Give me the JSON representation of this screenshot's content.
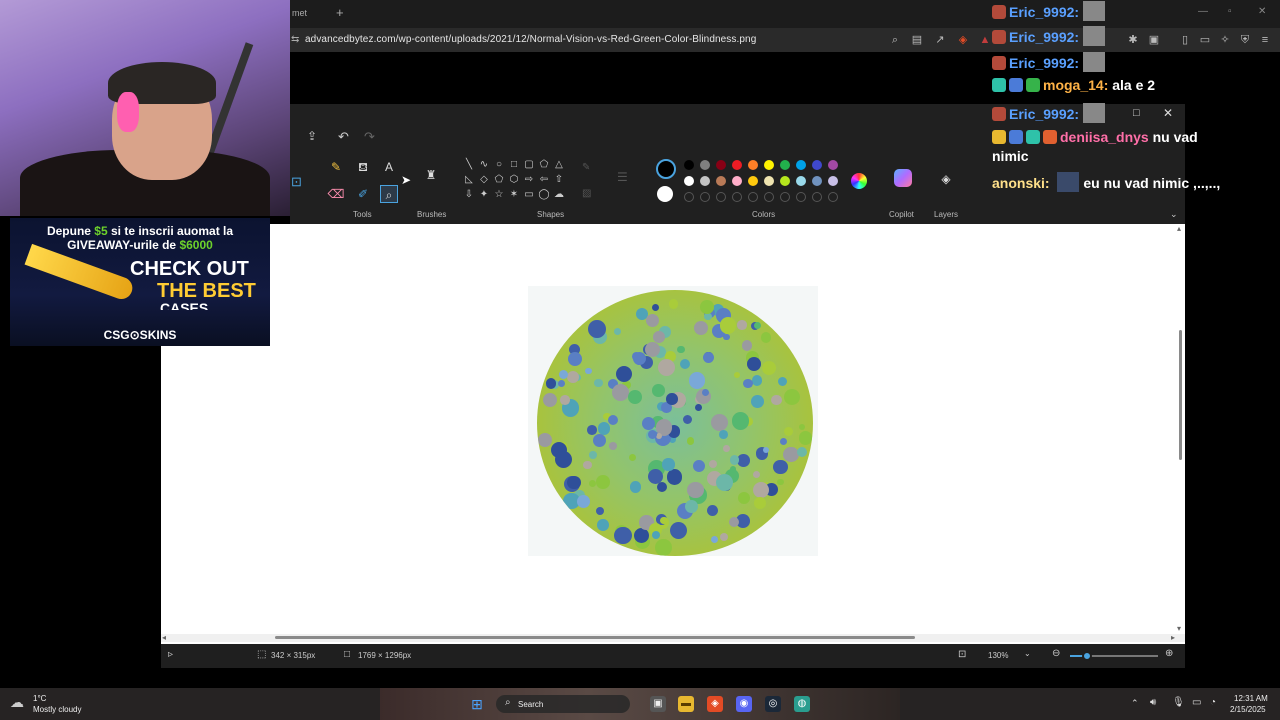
{
  "browser": {
    "tab_partial_label": "met",
    "new_tab_icon": "+",
    "url": "advancedbytez.com/wp-content/uploads/2021/12/Normal-Vision-vs-Red-Green-Color-Blindness.png"
  },
  "paint": {
    "ribbon_groups": [
      "Tools",
      "Brushes",
      "Shapes",
      "Colors",
      "Copilot",
      "Layers"
    ],
    "colors_row1": [
      "#000000",
      "#7f7f7f",
      "#880015",
      "#ed1c24",
      "#ff7f27",
      "#fff200",
      "#22b14c",
      "#00a2e8",
      "#3f48cc",
      "#a349a4"
    ],
    "colors_row2": [
      "#ffffff",
      "#c3c3c3",
      "#b97a57",
      "#ffaec9",
      "#ffc90e",
      "#efe4b0",
      "#b5e61d",
      "#99d9ea",
      "#7092be",
      "#c8bfe7"
    ],
    "status": {
      "selection_size": "342 × 315px",
      "image_size": "1769 × 1296px",
      "zoom": "130%"
    }
  },
  "taskbar": {
    "weather_temp": "1°C",
    "weather_desc": "Mostly cloudy",
    "search_label": "Search",
    "clock_time": "12:31 AM",
    "clock_date": "2/15/2025"
  },
  "overlay": {
    "ad": {
      "line1_pre": "Depune ",
      "line1_accent": "$5",
      "line1_post": " si te inscrii auomat la",
      "line2_pre": "GIVEAWAY-urile de ",
      "line2_accent": "$6000",
      "check_out": "CHECK OUT",
      "the_best": "THE BEST",
      "cases": "CASES",
      "brand": "CSG⊙SKINS"
    },
    "chat": [
      {
        "user": "Eric_9992:",
        "message": "",
        "user_color": "#5aa0ff"
      },
      {
        "user": "Eric_9992:",
        "message": "",
        "user_color": "#5aa0ff"
      },
      {
        "user": "Eric_9992:",
        "message": "",
        "user_color": "#5aa0ff"
      },
      {
        "user": "moga_14:",
        "message": "ala e 2",
        "user_color": "#ffb347"
      },
      {
        "user": "Eric_9992:",
        "message": "",
        "user_color": "#5aa0ff"
      },
      {
        "user": "deniisa_dnys",
        "message": "nu vad",
        "user_color": "#ff6fa8"
      },
      {
        "user": "",
        "message": "nimic",
        "user_color": "#ffffff"
      },
      {
        "user": "anonski:",
        "message": "eu nu vad nimic ,..,..,",
        "user_color": "#ffe08a"
      }
    ]
  }
}
